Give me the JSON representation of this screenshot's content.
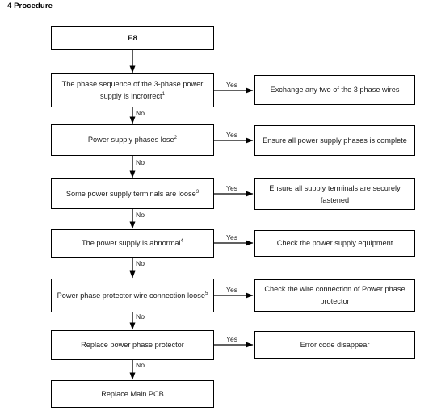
{
  "page": {
    "heading": "4 Procedure"
  },
  "flow": {
    "left_nodes": [
      {
        "id": "e8",
        "text": "E8",
        "sup": "",
        "bold": true
      },
      {
        "id": "phase-seq",
        "text": "The phase sequence of the 3-phase power supply is incrorrect",
        "sup": "1",
        "bold": false
      },
      {
        "id": "phase-lose",
        "text": "Power supply phases lose",
        "sup": "2",
        "bold": false
      },
      {
        "id": "term-loose",
        "text": "Some power supply terminals are loose",
        "sup": "3",
        "bold": false
      },
      {
        "id": "abnormal",
        "text": "The power supply is abnormal",
        "sup": "4",
        "bold": false
      },
      {
        "id": "protector-wire",
        "text": "Power phase protector wire connection loose",
        "sup": "5",
        "bold": false
      },
      {
        "id": "replace-protector",
        "text": "Replace power phase protector",
        "sup": "",
        "bold": false
      },
      {
        "id": "replace-pcb",
        "text": "Replace Main PCB",
        "sup": "",
        "bold": false
      }
    ],
    "right_nodes": [
      {
        "id": "exchange-wires",
        "text": "Exchange any two of the 3 phase wires"
      },
      {
        "id": "ensure-phases",
        "text": "Ensure all power supply phases is complete"
      },
      {
        "id": "ensure-terminals",
        "text": "Ensure all supply terminals are securely fastened"
      },
      {
        "id": "check-equipment",
        "text": "Check the power supply equipment"
      },
      {
        "id": "check-wire-conn",
        "text": "Check the wire connection of Power phase protector"
      },
      {
        "id": "error-disappear",
        "text": "Error code disappear"
      }
    ],
    "yes_labels": [
      "Yes",
      "Yes",
      "Yes",
      "Yes",
      "Yes",
      "Yes"
    ],
    "no_labels": [
      "No",
      "No",
      "No",
      "No",
      "No",
      "No"
    ],
    "colors": {
      "border": "#000000",
      "text": "#1b1b1b",
      "background": "#ffffff"
    }
  }
}
